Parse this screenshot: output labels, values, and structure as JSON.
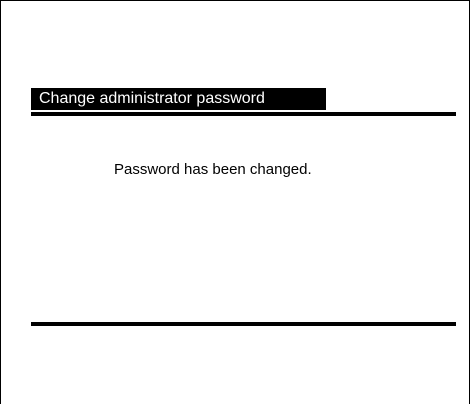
{
  "dialog": {
    "title": "Change administrator password",
    "message": "Password has been changed."
  }
}
